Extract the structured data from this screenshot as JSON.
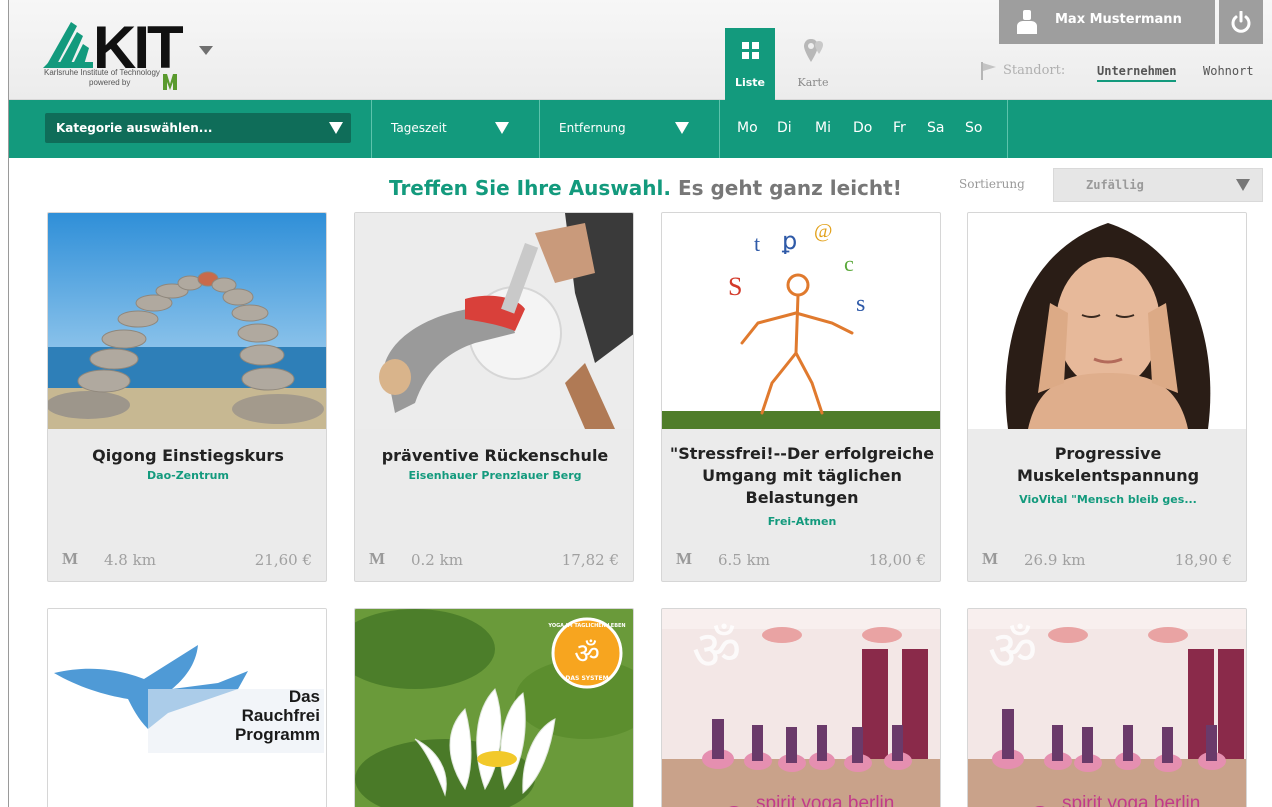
{
  "header": {
    "logo_text": "KIT",
    "logo_sub1": "Karlsruhe Institute of Technology",
    "logo_sub2": "powered by",
    "views": [
      {
        "label": "Liste",
        "active": true
      },
      {
        "label": "Karte",
        "active": false
      }
    ],
    "user_name": "Max Mustermann",
    "standort_label": "Standort:",
    "standort_options": [
      {
        "label": "Unternehmen",
        "active": true
      },
      {
        "label": "Wohnort",
        "active": false
      }
    ]
  },
  "filters": {
    "category_placeholder": "Kategorie auswählen...",
    "tageszeit": "Tageszeit",
    "entfernung": "Entfernung",
    "days": [
      "Mo",
      "Di",
      "Mi",
      "Do",
      "Fr",
      "Sa",
      "So"
    ]
  },
  "content": {
    "headline_strong": "Treffen Sie Ihre Auswahl.",
    "headline_rest": " Es geht ganz leicht!",
    "sort_label": "Sortierung",
    "sort_value": "Zufällig"
  },
  "cards": [
    {
      "title": "Qigong Einstiegskurs",
      "provider": "Dao-Zentrum",
      "distance": "4.8 km",
      "price": "21,60 €"
    },
    {
      "title": "präventive Rückenschule",
      "provider": "Eisenhauer Prenzlauer Berg",
      "distance": "0.2 km",
      "price": "17,82 €"
    },
    {
      "title": "\"Stressfrei!--Der erfolgreiche Umgang mit täglichen Belastungen",
      "provider": "Frei-Atmen",
      "distance": "6.5 km",
      "price": "18,00 €"
    },
    {
      "title": "Progressive Muskelentspannung",
      "provider": "VioVital \"Mensch bleib ges...",
      "distance": "26.9 km",
      "price": "18,90 €"
    }
  ],
  "row2": {
    "rauchfrei_text": [
      "Das",
      "Rauchfrei",
      "Programm"
    ],
    "yoga_badge_top": "YOGA IM TÄGLICHEN LEBEN",
    "yoga_badge_bottom": "DAS SYSTEM",
    "spirit_text": "spirit yoga berlin"
  },
  "colors": {
    "accent": "#139a7d",
    "accent_dark": "#0f6d59",
    "muted": "#9e9e9e"
  }
}
